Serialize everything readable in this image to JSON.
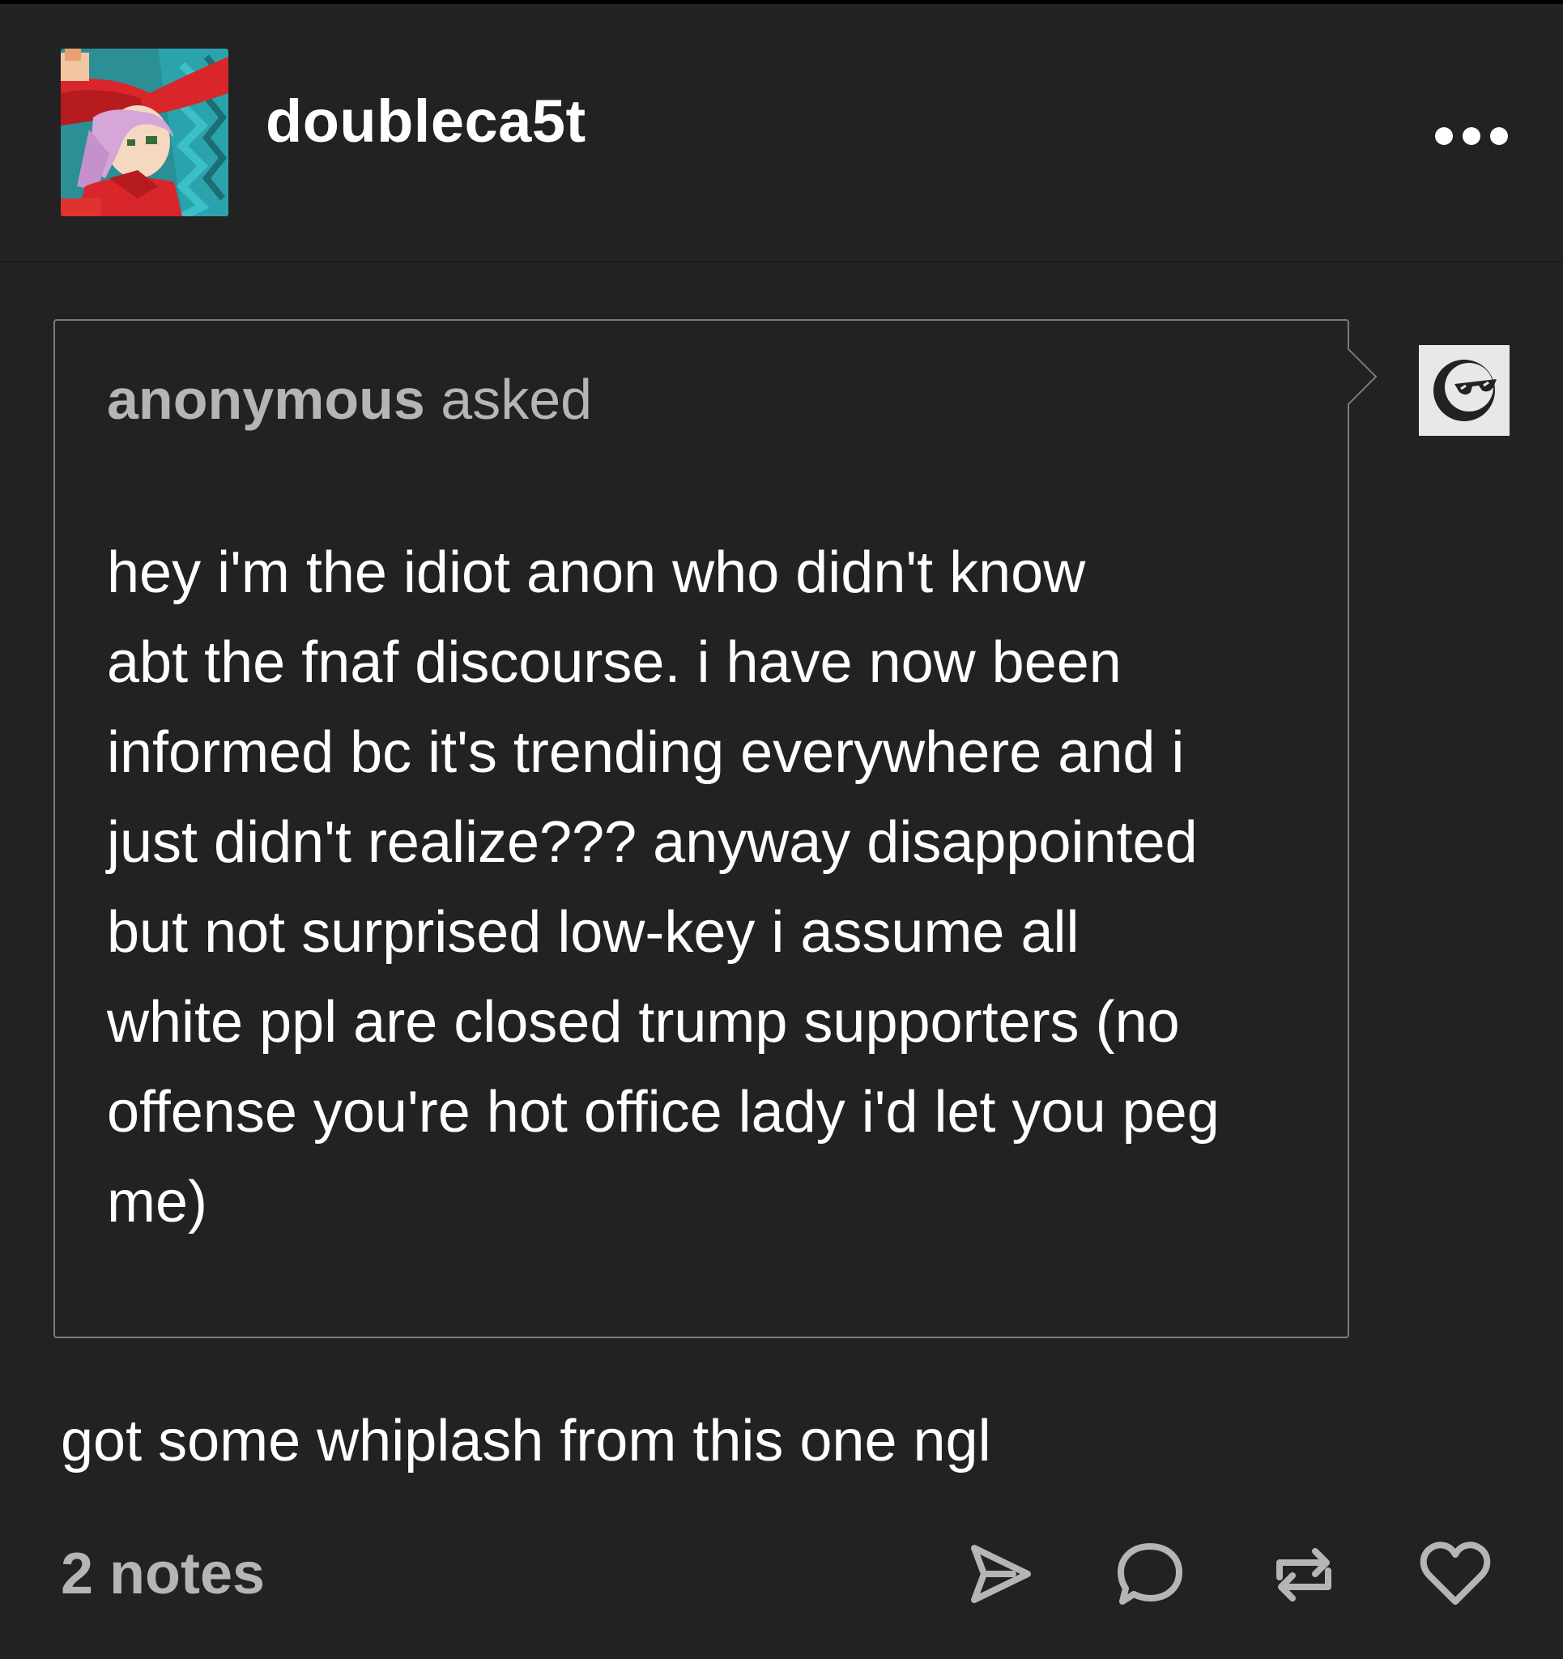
{
  "post": {
    "blog_name": "doubleca5t",
    "avatar_icon": "pixel-art-witch-avatar",
    "more_icon": "more-options-icon"
  },
  "ask": {
    "asker": "anonymous",
    "verb": " asked",
    "body": "hey i'm the idiot anon who didn't know\nabt the fnaf discourse. i have now been\ninformed bc it's trending everywhere and i\njust didn't realize??? anyway disappointed\nbut not surprised low-key i assume all\nwhite ppl are closed trump supporters (no\noffense you're hot office lady i'd let you peg\nme)",
    "asker_avatar_icon": "anonymous-sunglasses-icon"
  },
  "reply": {
    "text": "got some whiplash from this one ngl"
  },
  "footer": {
    "notes_label": "2 notes",
    "actions": [
      "share-icon",
      "reply-icon",
      "reblog-icon",
      "like-icon"
    ]
  },
  "colors": {
    "background": "#222222",
    "text": "#ffffff",
    "muted_text": "#b5b5b5",
    "border": "#7b7b7b"
  }
}
